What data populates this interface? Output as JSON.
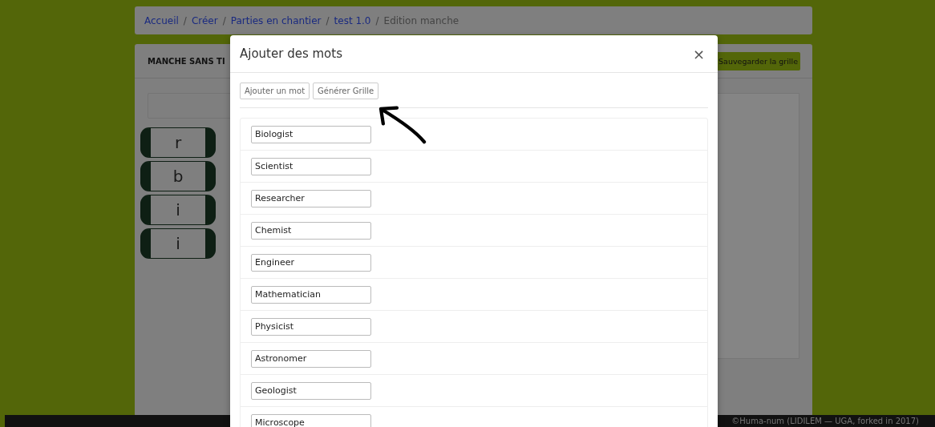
{
  "breadcrumb": {
    "separator": "/",
    "items": [
      "Accueil",
      "Créer",
      "Parties en chantier",
      "test 1.0",
      "Edition manche"
    ]
  },
  "card": {
    "title": "MANCHE SANS TI",
    "save_button": "Sauvegarder la grille"
  },
  "tiles": [
    "r",
    "b",
    "i",
    "i"
  ],
  "modal": {
    "title": "Ajouter des mots",
    "close": "×",
    "buttons": [
      "Ajouter un mot",
      "Générer Grille"
    ],
    "words": [
      "Biologist",
      "Scientist",
      "Researcher",
      "Chemist",
      "Engineer",
      "Mathematician",
      "Physicist",
      "Astronomer",
      "Geologist",
      "Microscope"
    ]
  },
  "footer": "©Huma-num (LIDILEM — UGA, forked in 2017)"
}
